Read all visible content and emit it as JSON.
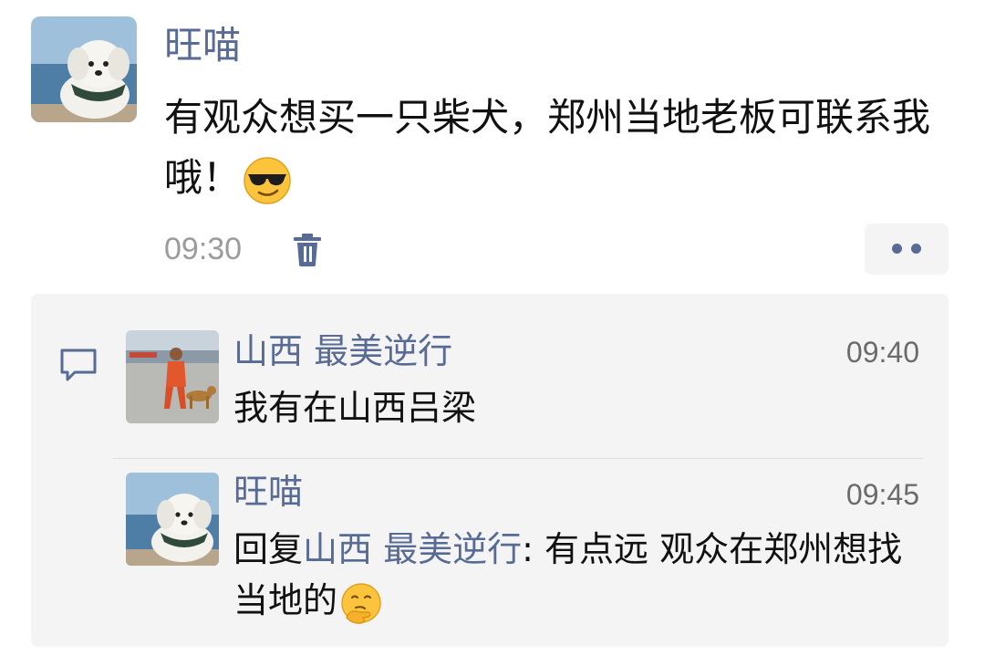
{
  "post": {
    "author": "旺喵",
    "text": "有观众想买一只柴犬，郑州当地老板可联系我哦！",
    "emoji": "sunglasses-emoji",
    "time": "09:30",
    "icons": {
      "delete": "trash-icon",
      "more": "more-dots-icon"
    }
  },
  "comments": {
    "icon": "comment-bubble-icon",
    "items": [
      {
        "author": "山西 最美逆行",
        "time": "09:40",
        "text": "我有在山西吕梁"
      },
      {
        "author": "旺喵",
        "time": "09:45",
        "reply_prefix": "回复",
        "reply_to": "山西 最美逆行",
        "reply_sep": ": ",
        "text": "有点远 观众在郑州想找当地的",
        "emoji": "thinking-hand-emoji"
      }
    ]
  },
  "colors": {
    "name_link": "#576b95",
    "text": "#111111",
    "time": "#9b9b9b",
    "comment_bg": "#f4f4f4"
  }
}
